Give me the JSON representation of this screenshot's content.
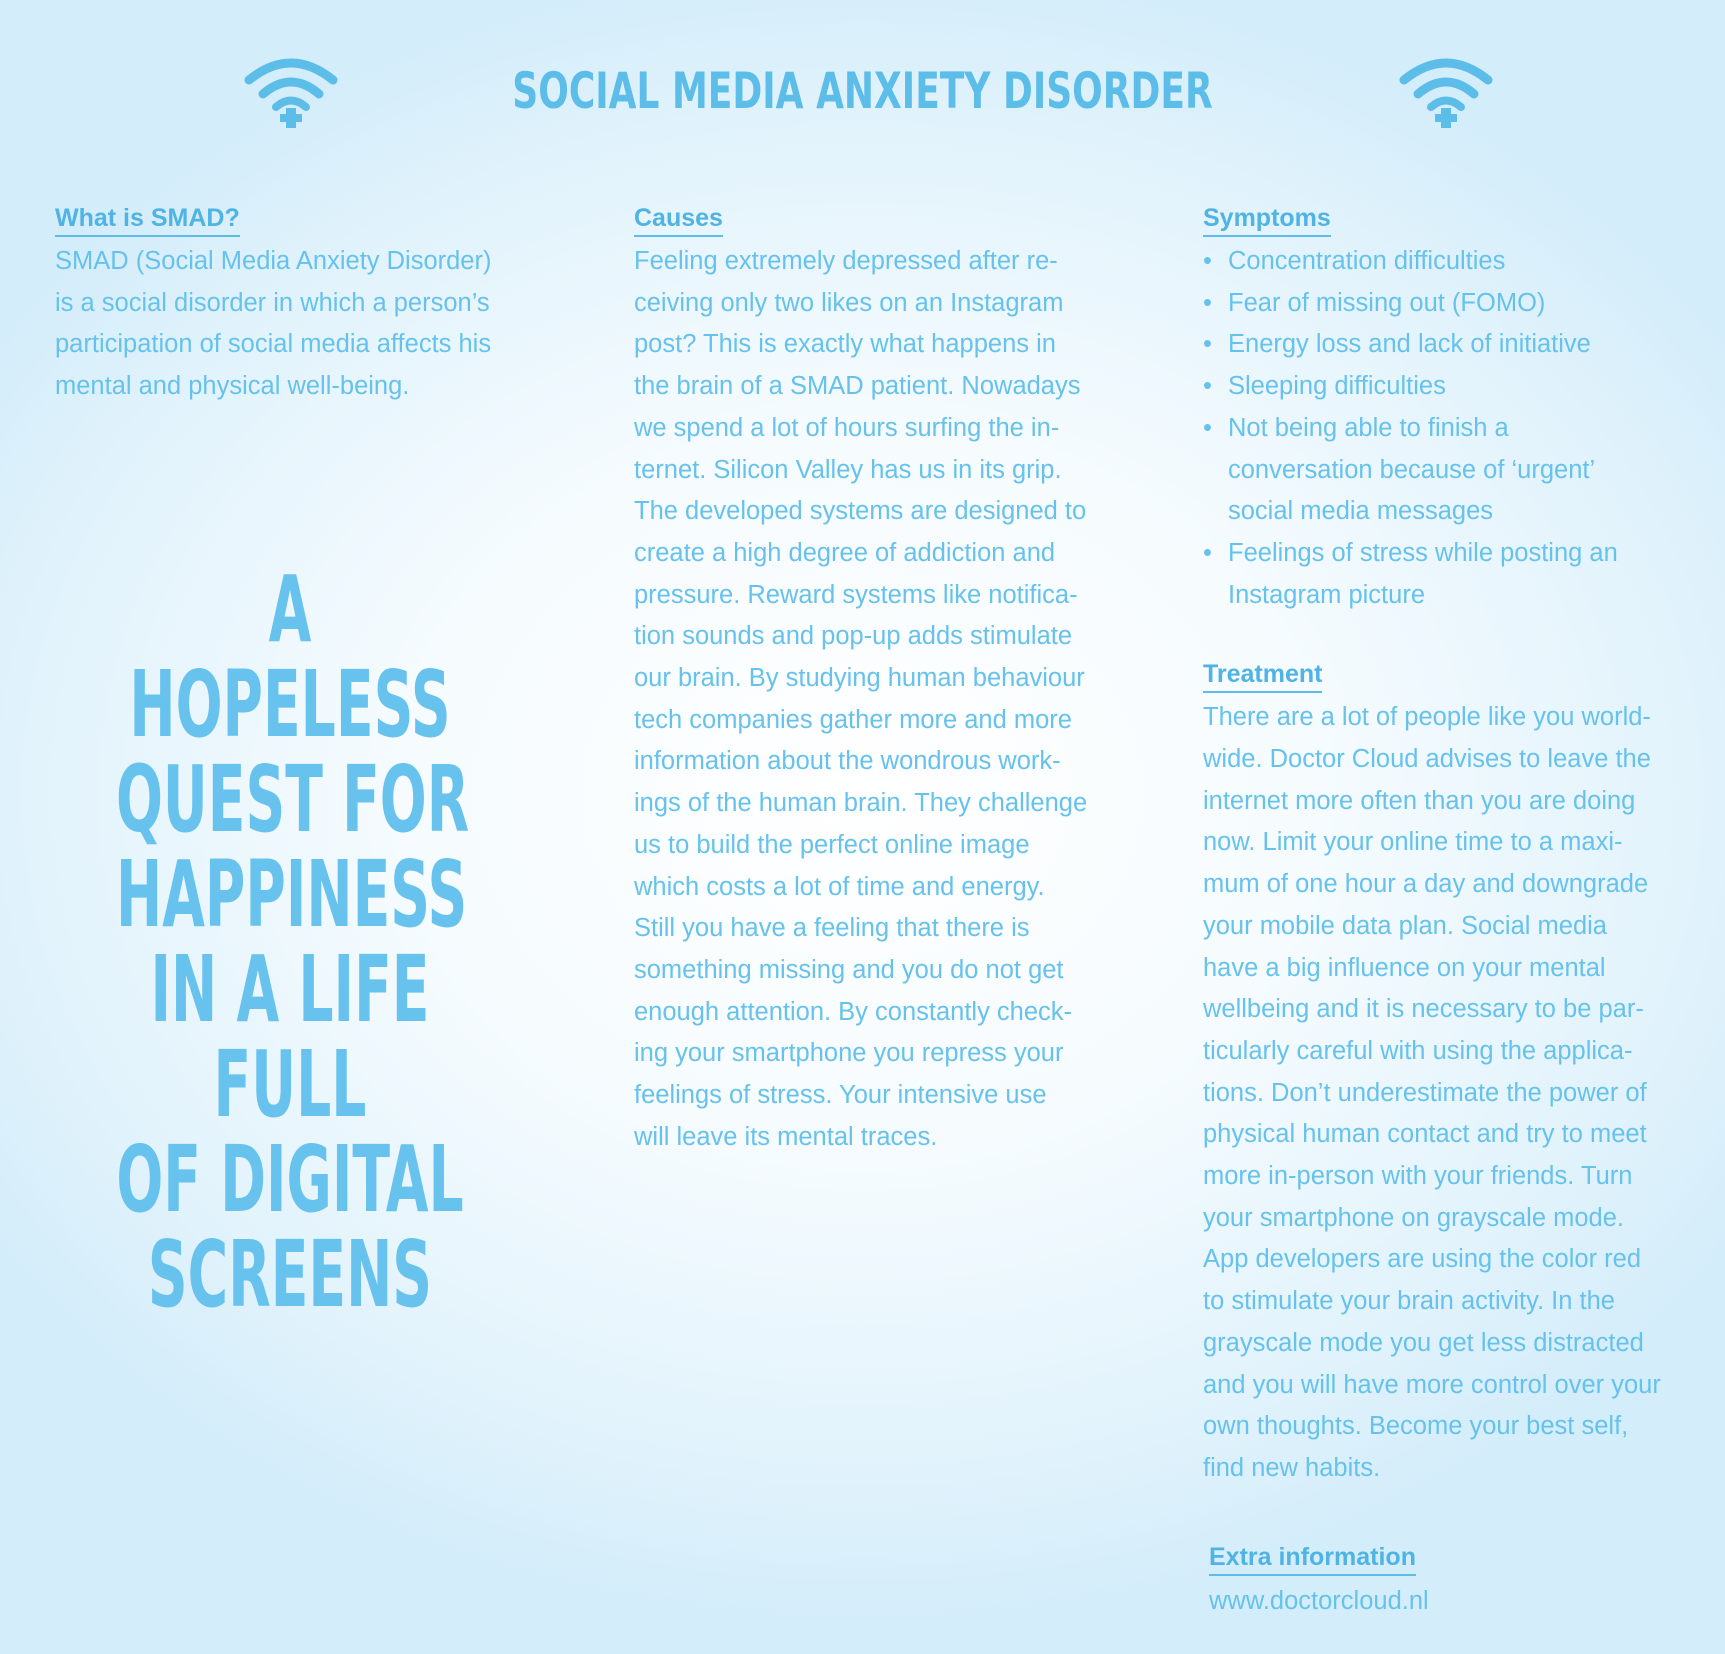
{
  "header": {
    "title": "SOCIAL MEDIA ANXIETY DISORDER",
    "left_icon": "wifi-plus-icon",
    "right_icon": "wifi-plus-icon"
  },
  "what_is": {
    "heading": "What is SMAD?",
    "lines": [
      "SMAD (Social Media Anxiety Disorder)",
      "is a social disorder in which a person’s",
      "participation of social media affects his",
      "mental and physical well-being."
    ]
  },
  "causes": {
    "heading": "Causes",
    "lines": [
      "Feeling extremely depressed after re-",
      "ceiving only two likes on an Instagram",
      "post? This is exactly what happens in",
      "the brain of a SMAD patient. Nowadays",
      "we spend a lot of hours surfing the in-",
      "ternet. Silicon Valley has us in its grip.",
      "The developed systems are designed to",
      "create a high degree of addiction and",
      "pressure. Reward systems like notifica-",
      "tion sounds and pop-up adds stimulate",
      "our brain. By studying human behaviour",
      "tech companies gather more and more",
      "information about the wondrous work-",
      "ings of the human brain. They challenge",
      "us to build the perfect online image",
      "which costs a lot of time and energy.",
      "Still you have a feeling that there is",
      "something missing and you do not get",
      "enough attention. By constantly check-",
      "ing your smartphone you repress your",
      "feelings of stress. Your intensive use",
      "will leave its mental traces."
    ]
  },
  "symptoms": {
    "heading": "Symptoms",
    "items": [
      "Concentration difficulties",
      "Fear of missing out (FOMO)",
      "Energy loss and lack of initiative",
      "Sleeping difficulties",
      "Not being able to finish a\nconversation because of ‘urgent’\nsocial media messages",
      "Feelings of stress while posting an\nInstagram picture"
    ]
  },
  "treatment": {
    "heading": "Treatment",
    "lines": [
      "There are a lot of people like you world-",
      "wide. Doctor Cloud advises to leave the",
      "internet more often than you are doing",
      "now. Limit your online time to a maxi-",
      "mum of one hour a day and downgrade",
      "your mobile data plan. Social media",
      "have a big influence on your mental",
      "wellbeing and it is necessary to be par-",
      "ticularly careful with using the applica-",
      "tions. Don’t underestimate the power of",
      "physical human contact and try to meet",
      "more in-person with your friends. Turn",
      "your smartphone on grayscale mode.",
      "App developers are using the color red",
      "to stimulate your brain activity. In the",
      "grayscale mode you get less distracted",
      "and you will have more control over your",
      "own thoughts. Become your best self,",
      "find new habits."
    ]
  },
  "extra": {
    "heading": "Extra information",
    "url": "www.doctorcloud.nl"
  },
  "slogan": {
    "lines": [
      "A",
      "HOPELESS",
      "QUEST FOR",
      "HAPPINESS",
      "IN A LIFE",
      "FULL",
      "OF DIGITAL",
      "SCREENS"
    ]
  },
  "colors": {
    "accent": "#5cbde9",
    "background": "#e2f3fc"
  }
}
